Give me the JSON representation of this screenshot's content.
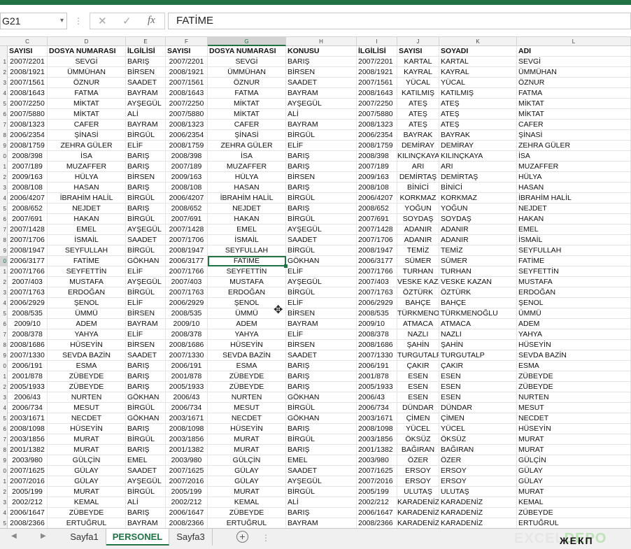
{
  "formula_bar": {
    "name_box": "G21",
    "name_box_dropdown": "▾",
    "cancel_symbol": "✕",
    "enter_symbol": "✓",
    "fx_label": "fx",
    "formula_value": "FATİME"
  },
  "column_letters": [
    "C",
    "D",
    "E",
    "F",
    "G",
    "H",
    "I",
    "J",
    "K",
    "L"
  ],
  "row_labels": [
    "",
    "1",
    "2",
    "3",
    "4",
    "5",
    "6",
    "7",
    "8",
    "9",
    "0",
    "1",
    "2",
    "3",
    "4",
    "5",
    "6",
    "7",
    "8",
    "9",
    "0",
    "1",
    "2",
    "3",
    "4",
    "5",
    "6",
    "7",
    "8",
    "9",
    "0",
    "1",
    "2",
    "3",
    "4",
    "5",
    "6",
    "7",
    "8",
    "9",
    "0",
    "1",
    "2",
    "3",
    "4",
    "5",
    "6",
    "7",
    "8",
    "9"
  ],
  "table_headers": [
    "SAYISI",
    "DOSYA NUMARASI",
    "İLGİLİSİ",
    "SAYISI",
    "DOSYA NUMARASI",
    "KONUSU",
    "İLGİLİSİ",
    "SAYISI",
    "SOYADI",
    "ADI"
  ],
  "rows": [
    [
      "2007/2201",
      "SEVGİ",
      "BARIŞ",
      "2007/2201",
      "SEVGİ",
      "BARIŞ",
      "2007/2201",
      "KARTAL",
      "KARTAL",
      "SEVGİ"
    ],
    [
      "2008/1921",
      "ÜMMÜHAN",
      "BİRSEN",
      "2008/1921",
      "ÜMMÜHAN",
      "BİRSEN",
      "2008/1921",
      "KAYRAL",
      "KAYRAL",
      "ÜMMÜHAN"
    ],
    [
      "2007/1561",
      "ÖZNUR",
      "SAADET",
      "2007/1561",
      "ÖZNUR",
      "SAADET",
      "2007/1561",
      "YÜCAL",
      "YÜCAL",
      "ÖZNUR"
    ],
    [
      "2008/1643",
      "FATMA",
      "BAYRAM",
      "2008/1643",
      "FATMA",
      "BAYRAM",
      "2008/1643",
      "KATILMIŞ",
      "KATILMIŞ",
      "FATMA"
    ],
    [
      "2007/2250",
      "MİKTAT",
      "AYŞEGÜL",
      "2007/2250",
      "MİKTAT",
      "AYŞEGÜL",
      "2007/2250",
      "ATEŞ",
      "ATEŞ",
      "MİKTAT"
    ],
    [
      "2007/5880",
      "MİKTAT",
      "ALİ",
      "2007/5880",
      "MİKTAT",
      "ALİ",
      "2007/5880",
      "ATEŞ",
      "ATEŞ",
      "MİKTAT"
    ],
    [
      "2008/1323",
      "CAFER",
      "BAYRAM",
      "2008/1323",
      "CAFER",
      "BAYRAM",
      "2008/1323",
      "ATEŞ",
      "ATEŞ",
      "CAFER"
    ],
    [
      "2006/2354",
      "ŞİNASİ",
      "BİRGÜL",
      "2006/2354",
      "ŞİNASİ",
      "BİRGÜL",
      "2006/2354",
      "BAYRAK",
      "BAYRAK",
      "ŞİNASİ"
    ],
    [
      "2008/1759",
      "ZEHRA GÜLER",
      "ELİF",
      "2008/1759",
      "ZEHRA GÜLER",
      "ELİF",
      "2008/1759",
      "DEMİRAY",
      "DEMİRAY",
      "ZEHRA GÜLER"
    ],
    [
      "2008/398",
      "İSA",
      "BARIŞ",
      "2008/398",
      "İSA",
      "BARIŞ",
      "2008/398",
      "KILINÇKAYA",
      "KILINÇKAYA",
      "İSA"
    ],
    [
      "2007/189",
      "MUZAFFER",
      "BARIŞ",
      "2007/189",
      "MUZAFFER",
      "BARIŞ",
      "2007/189",
      "ARI",
      "ARI",
      "MUZAFFER"
    ],
    [
      "2009/163",
      "HÜLYA",
      "BİRSEN",
      "2009/163",
      "HÜLYA",
      "BİRSEN",
      "2009/163",
      "DEMİRTAŞ",
      "DEMİRTAŞ",
      "HÜLYA"
    ],
    [
      "2008/108",
      "HASAN",
      "BARIŞ",
      "2008/108",
      "HASAN",
      "BARIŞ",
      "2008/108",
      "BİNİCİ",
      "BİNİCİ",
      "HASAN"
    ],
    [
      "2006/4207",
      "İBRAHİM HALİL",
      "BİRGÜL",
      "2006/4207",
      "İBRAHİM HALİL",
      "BİRGÜL",
      "2006/4207",
      "KORKMAZ",
      "KORKMAZ",
      "İBRAHİM HALİL"
    ],
    [
      "2008/652",
      "NEJDET",
      "BARIŞ",
      "2008/652",
      "NEJDET",
      "BARIŞ",
      "2008/652",
      "YOĞUN",
      "YOĞUN",
      "NEJDET"
    ],
    [
      "2007/691",
      "HAKAN",
      "BİRGÜL",
      "2007/691",
      "HAKAN",
      "BİRGÜL",
      "2007/691",
      "SOYDAŞ",
      "SOYDAŞ",
      "HAKAN"
    ],
    [
      "2007/1428",
      "EMEL",
      "AYŞEGÜL",
      "2007/1428",
      "EMEL",
      "AYŞEGÜL",
      "2007/1428",
      "ADANIR",
      "ADANIR",
      "EMEL"
    ],
    [
      "2007/1706",
      "İSMAİL",
      "SAADET",
      "2007/1706",
      "İSMAİL",
      "SAADET",
      "2007/1706",
      "ADANIR",
      "ADANIR",
      "İSMAİL"
    ],
    [
      "2008/1947",
      "SEYFULLAH",
      "BİRGÜL",
      "2008/1947",
      "SEYFULLAH",
      "BİRGÜL",
      "2008/1947",
      "TEMİZ",
      "TEMİZ",
      "SEYFULLAH"
    ],
    [
      "2006/3177",
      "FATİME",
      "GÖKHAN",
      "2006/3177",
      "FATİME",
      "GÖKHAN",
      "2006/3177",
      "SÜMER",
      "SÜMER",
      "FATİME"
    ],
    [
      "2007/1766",
      "SEYFETTİN",
      "ELİF",
      "2007/1766",
      "SEYFETTİN",
      "ELİF",
      "2007/1766",
      "TURHAN",
      "TURHAN",
      "SEYFETTİN"
    ],
    [
      "2007/403",
      "MUSTAFA",
      "AYŞEGÜL",
      "2007/403",
      "MUSTAFA",
      "AYŞEGÜL",
      "2007/403",
      "VESKE KAZAN",
      "VESKE KAZAN",
      "MUSTAFA"
    ],
    [
      "2007/1763",
      "ERDOĞAN",
      "BİRGÜL",
      "2007/1763",
      "ERDOĞAN",
      "BİRGÜL",
      "2007/1763",
      "ÖZTÜRK",
      "ÖZTÜRK",
      "ERDOĞAN"
    ],
    [
      "2006/2929",
      "ŞENOL",
      "ELİF",
      "2006/2929",
      "ŞENOL",
      "ELİF",
      "2006/2929",
      "BAHÇE",
      "BAHÇE",
      "ŞENOL"
    ],
    [
      "2008/535",
      "ÜMMÜ",
      "BİRSEN",
      "2008/535",
      "ÜMMÜ",
      "BİRSEN",
      "2008/535",
      "TÜRKMENOĞLU",
      "TÜRKMENOĞLU",
      "ÜMMÜ"
    ],
    [
      "2009/10",
      "ADEM",
      "BAYRAM",
      "2009/10",
      "ADEM",
      "BAYRAM",
      "2009/10",
      "ATMACA",
      "ATMACA",
      "ADEM"
    ],
    [
      "2008/378",
      "YAHYA",
      "ELİF",
      "2008/378",
      "YAHYA",
      "ELİF",
      "2008/378",
      "NAZLI",
      "NAZLI",
      "YAHYA"
    ],
    [
      "2008/1686",
      "HÜSEYİN",
      "BİRSEN",
      "2008/1686",
      "HÜSEYİN",
      "BİRSEN",
      "2008/1686",
      "ŞAHİN",
      "ŞAHİN",
      "HÜSEYİN"
    ],
    [
      "2007/1330",
      "SEVDA BAZİN",
      "SAADET",
      "2007/1330",
      "SEVDA BAZİN",
      "SAADET",
      "2007/1330",
      "TURGUTALP",
      "TURGUTALP",
      "SEVDA BAZİN"
    ],
    [
      "2006/191",
      "ESMA",
      "BARIŞ",
      "2006/191",
      "ESMA",
      "BARIŞ",
      "2006/191",
      "ÇAKIR",
      "ÇAKIR",
      "ESMA"
    ],
    [
      "2001/878",
      "ZÜBEYDE",
      "BARIŞ",
      "2001/878",
      "ZÜBEYDE",
      "BARIŞ",
      "2001/878",
      "ESEN",
      "ESEN",
      "ZÜBEYDE"
    ],
    [
      "2005/1933",
      "ZÜBEYDE",
      "BARIŞ",
      "2005/1933",
      "ZÜBEYDE",
      "BARIŞ",
      "2005/1933",
      "ESEN",
      "ESEN",
      "ZÜBEYDE"
    ],
    [
      "2006/43",
      "NURTEN",
      "GÖKHAN",
      "2006/43",
      "NURTEN",
      "GÖKHAN",
      "2006/43",
      "ESEN",
      "ESEN",
      "NURTEN"
    ],
    [
      "2006/734",
      "MESUT",
      "BİRGÜL",
      "2006/734",
      "MESUT",
      "BİRGÜL",
      "2006/734",
      "DÜNDAR",
      "DÜNDAR",
      "MESUT"
    ],
    [
      "2003/1671",
      "NECDET",
      "GÖKHAN",
      "2003/1671",
      "NECDET",
      "GÖKHAN",
      "2003/1671",
      "ÇİMEN",
      "ÇİMEN",
      "NECDET"
    ],
    [
      "2008/1098",
      "HÜSEYİN",
      "BARIŞ",
      "2008/1098",
      "HÜSEYİN",
      "BARIŞ",
      "2008/1098",
      "YÜCEL",
      "YÜCEL",
      "HÜSEYİN"
    ],
    [
      "2003/1856",
      "MURAT",
      "BİRGÜL",
      "2003/1856",
      "MURAT",
      "BİRGÜL",
      "2003/1856",
      "ÖKSÜZ",
      "ÖKSÜZ",
      "MURAT"
    ],
    [
      "2001/1382",
      "MURAT",
      "BARIŞ",
      "2001/1382",
      "MURAT",
      "BARIŞ",
      "2001/1382",
      "BAĞIRAN",
      "BAĞIRAN",
      "MURAT"
    ],
    [
      "2003/980",
      "GÜLÇİN",
      "EMEL",
      "2003/980",
      "GÜLÇİN",
      "EMEL",
      "2003/980",
      "ÖZER",
      "ÖZER",
      "GÜLÇİN"
    ],
    [
      "2007/1625",
      "GÜLAY",
      "SAADET",
      "2007/1625",
      "GÜLAY",
      "SAADET",
      "2007/1625",
      "ERSOY",
      "ERSOY",
      "GÜLAY"
    ],
    [
      "2007/2016",
      "GÜLAY",
      "AYŞEGÜL",
      "2007/2016",
      "GÜLAY",
      "AYŞEGÜL",
      "2007/2016",
      "ERSOY",
      "ERSOY",
      "GÜLAY"
    ],
    [
      "2005/199",
      "MURAT",
      "BİRGÜL",
      "2005/199",
      "MURAT",
      "BİRGÜL",
      "2005/199",
      "ULUTAŞ",
      "ULUTAŞ",
      "MURAT"
    ],
    [
      "2002/212",
      "KEMAL",
      "ALİ",
      "2002/212",
      "KEMAL",
      "ALİ",
      "2002/212",
      "KARADENİZ",
      "KARADENİZ",
      "KEMAL"
    ],
    [
      "2006/1647",
      "ZÜBEYDE",
      "BARIŞ",
      "2006/1647",
      "ZÜBEYDE",
      "BARIŞ",
      "2006/1647",
      "KARADENİZ",
      "KARADENİZ",
      "ZÜBEYDE"
    ],
    [
      "2008/2366",
      "ERTUĞRUL",
      "BAYRAM",
      "2008/2366",
      "ERTUĞRUL",
      "BAYRAM",
      "2008/2366",
      "KARADENİZ",
      "KARADENİZ",
      "ERTUĞRUL"
    ]
  ],
  "selected_cell": {
    "row_index": 19,
    "col_index": 4
  },
  "sheet_tabs": {
    "prev": "◀",
    "next": "▶",
    "tabs": [
      "Sayfa1",
      "PERSONEL",
      "Sayfa3"
    ],
    "active": "PERSONEL",
    "add": "+",
    "separator": "⋮"
  },
  "watermark": {
    "left": "EXCEL",
    "right": "DEPO",
    "overlay": "ЖЕКП"
  },
  "cursor_icon": "✥",
  "colors": {
    "accent": "#217346",
    "grid": "#e4e4e4",
    "header_bg": "#f2f2f2"
  }
}
